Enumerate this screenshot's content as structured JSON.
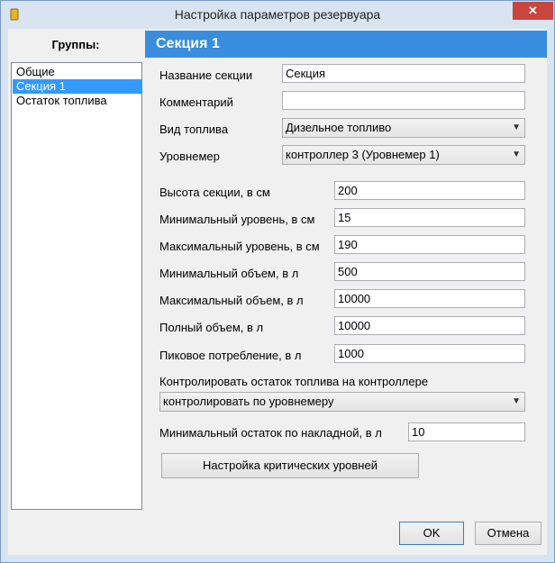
{
  "window": {
    "title": "Настройка параметров резервуара",
    "close_label": "✕"
  },
  "groups": {
    "label": "Группы:",
    "items": [
      "Общие",
      "Секция 1",
      "Остаток топлива"
    ],
    "selected": "Секция 1"
  },
  "section": {
    "title": "Секция 1",
    "name_label": "Название секции",
    "name_value": "Секция",
    "comment_label": "Комментарий",
    "comment_value": "",
    "fuel_type_label": "Вид топлива",
    "fuel_type_value": "Дизельное топливо",
    "level_gauge_label": "Уровнемер",
    "level_gauge_value": "контроллер 3 (Уровнемер 1)",
    "height_label": "Высота секции, в см",
    "height_value": "200",
    "min_level_label": "Минимальный уровень, в см",
    "min_level_value": "15",
    "max_level_label": "Максимальный уровень, в см",
    "max_level_value": "190",
    "min_volume_label": "Минимальный объем, в л",
    "min_volume_value": "500",
    "max_volume_label": "Максимальный объем, в л",
    "max_volume_value": "10000",
    "full_volume_label": "Полный объем, в л",
    "full_volume_value": "10000",
    "peak_label": "Пиковое потребление, в л",
    "peak_value": "1000",
    "control_label": "Контролировать остаток топлива на контроллере",
    "control_value": "контролировать по уровнемеру",
    "min_residue_label": "Минимальный остаток по накладной, в л",
    "min_residue_value": "10",
    "critical_button": "Настройка критических уровней"
  },
  "buttons": {
    "ok": "OK",
    "cancel": "Отмена"
  },
  "colors": {
    "header_bg": "#3a8dde",
    "selection_bg": "#3399ff",
    "close_bg": "#c7463f"
  }
}
